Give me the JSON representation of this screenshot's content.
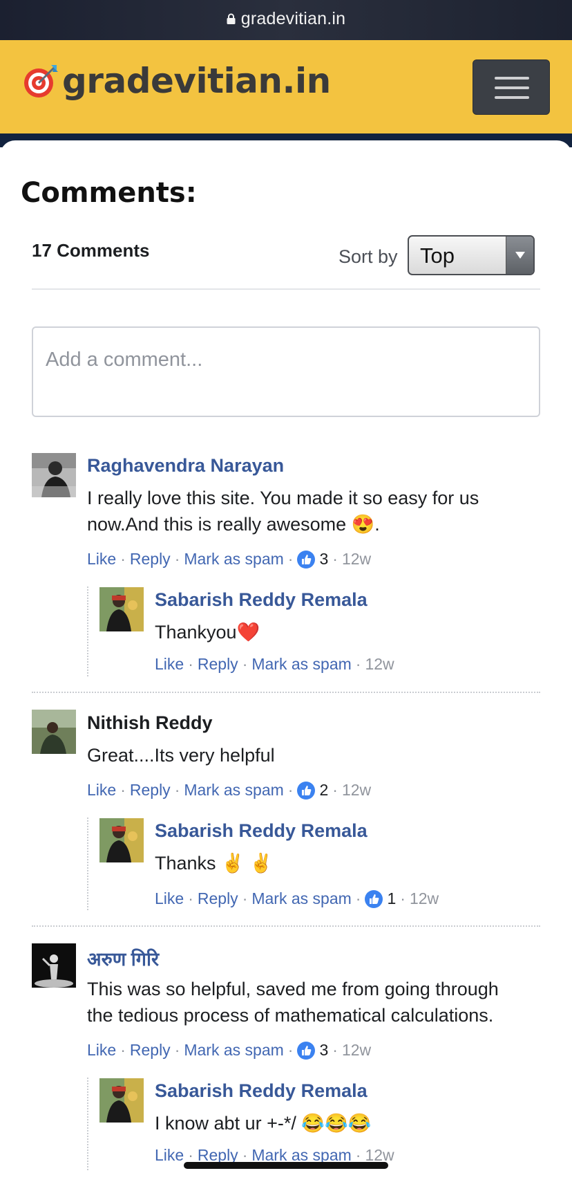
{
  "browser": {
    "url": "gradevitian.in"
  },
  "header": {
    "logo_text": "gradevitian.in",
    "logo_icon": "target-dart-icon",
    "menu_icon": "hamburger-menu-icon"
  },
  "page": {
    "heading": "Comments:"
  },
  "comments_plugin": {
    "count_label": "17 Comments",
    "sort_label": "Sort by",
    "sort_value": "Top",
    "input_placeholder": "Add a comment...",
    "action_like": "Like",
    "action_reply": "Reply",
    "action_spam": "Mark as spam",
    "separator": "·"
  },
  "comments": [
    {
      "author": "Raghavendra Narayan",
      "lines": [
        "I really love this site. You made it so easy for us",
        "now.And this is really awesome 😍."
      ],
      "likes": "3",
      "time": "12w",
      "reply": {
        "author": "Sabarish Reddy Remala",
        "text": "Thankyou❤️",
        "likes": "",
        "time": "12w"
      }
    },
    {
      "author": "Nithish Reddy",
      "lines": [
        "Great....Its very helpful"
      ],
      "likes": "2",
      "time": "12w",
      "reply": {
        "author": "Sabarish Reddy Remala",
        "text": "Thanks ✌️ ✌️",
        "likes": "1",
        "time": "12w"
      }
    },
    {
      "author": "अरुण गिरि",
      "lines": [
        "This was so helpful, saved me from going through",
        "the tedious process of mathematical calculations."
      ],
      "likes": "3",
      "time": "12w",
      "reply": {
        "author": "Sabarish Reddy Remala",
        "text": "I know abt ur +-*/ 😂😂😂",
        "likes": "",
        "time": "12w"
      }
    }
  ],
  "colors": {
    "header_bg": "#f3c340",
    "link": "#4267b2",
    "author": "#385898",
    "menu_btn": "#3b3f45"
  }
}
